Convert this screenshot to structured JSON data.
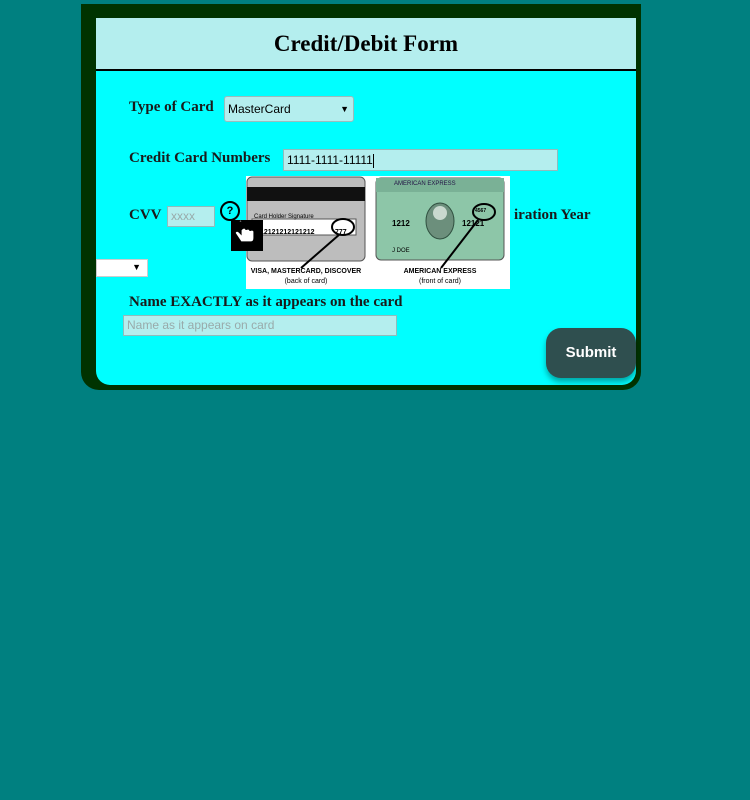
{
  "form": {
    "title": "Credit/Debit Form",
    "card_type_label": "Type of Card",
    "card_type_value": "MasterCard",
    "card_numbers_label": "Credit Card Numbers",
    "card_numbers_value": "1111-1111-11111",
    "cvv_label": "CVV",
    "cvv_placeholder": "xxxx",
    "help_icon_text": "?",
    "expiration_year_label_visible": "iration Year",
    "name_label": "Name EXACTLY as it appears on the card",
    "name_placeholder": "Name as it appears on card",
    "submit_label": "Submit"
  },
  "card_image": {
    "back_stripe_text": "Card Holder Signature",
    "back_number": "12121212121212",
    "back_cvv": "777",
    "back_caption_1": "VISA, MASTERCARD, DISCOVER",
    "back_caption_2": "(back of card)",
    "front_brand": "AMERICAN EXPRESS",
    "front_num_left": "1212",
    "front_num_right": "12121",
    "front_cvv": "4567",
    "front_name": "J DOE",
    "front_caption_1": "AMERICAN EXPRESS",
    "front_caption_2": "(front of card)"
  },
  "icons": {
    "dropdown": "triangle-down",
    "help": "question-circle",
    "cursor": "hand-pointer"
  },
  "colors": {
    "page_bg": "#008080",
    "panel_bg": "#00ffff",
    "header_bg": "#b4eeee",
    "frame": "#003300",
    "submit_bg": "#2f4f4f"
  }
}
